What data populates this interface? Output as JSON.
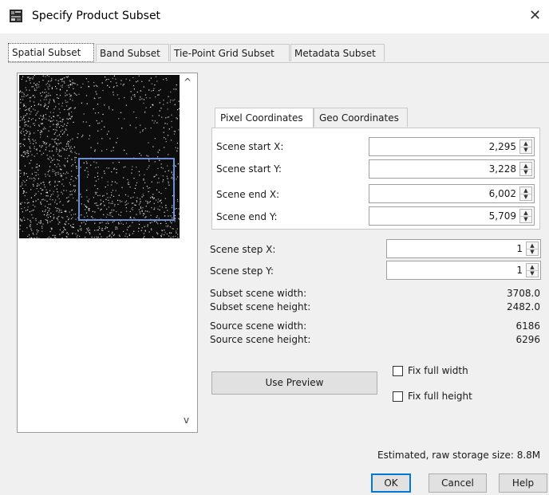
{
  "window": {
    "title": "Specify Product Subset",
    "close_symbol": "✕",
    "icon": "snap-app-icon"
  },
  "tabs": [
    {
      "label": "Spatial Subset",
      "active": true
    },
    {
      "label": "Band Subset",
      "active": false
    },
    {
      "label": "Tie-Point Grid Subset",
      "active": false
    },
    {
      "label": "Metadata Subset",
      "active": false
    }
  ],
  "thumbnail": {
    "scroll_up": "^",
    "scroll_down": "v"
  },
  "coord_tabs": [
    {
      "label": "Pixel Coordinates",
      "active": true
    },
    {
      "label": "Geo Coordinates",
      "active": false
    }
  ],
  "pixel_coords": {
    "scene_start_x": {
      "label": "Scene start X:",
      "value": "2,295"
    },
    "scene_start_y": {
      "label": "Scene start Y:",
      "value": "3,228"
    },
    "scene_end_x": {
      "label": "Scene end X:",
      "value": "6,002"
    },
    "scene_end_y": {
      "label": "Scene end Y:",
      "value": "5,709"
    }
  },
  "step": {
    "scene_step_x": {
      "label": "Scene step X:",
      "value": "1"
    },
    "scene_step_y": {
      "label": "Scene step Y:",
      "value": "1"
    }
  },
  "info": {
    "subset_width": {
      "label": "Subset scene width:",
      "value": "3708.0"
    },
    "subset_height": {
      "label": "Subset scene height:",
      "value": "2482.0"
    },
    "source_width": {
      "label": "Source scene width:",
      "value": "6186"
    },
    "source_height": {
      "label": "Source scene height:",
      "value": "6296"
    }
  },
  "preview_button": "Use Preview",
  "checkboxes": {
    "fix_full_width": {
      "label": "Fix full width",
      "checked": false
    },
    "fix_full_height": {
      "label": "Fix full height",
      "checked": false
    }
  },
  "storage_text": "Estimated, raw storage size: 8.8M",
  "buttons": {
    "ok": "OK",
    "cancel": "Cancel",
    "help": "Help"
  },
  "colors": {
    "selection_rect": "#6d8fd6",
    "primary_border": "#0078d7"
  }
}
